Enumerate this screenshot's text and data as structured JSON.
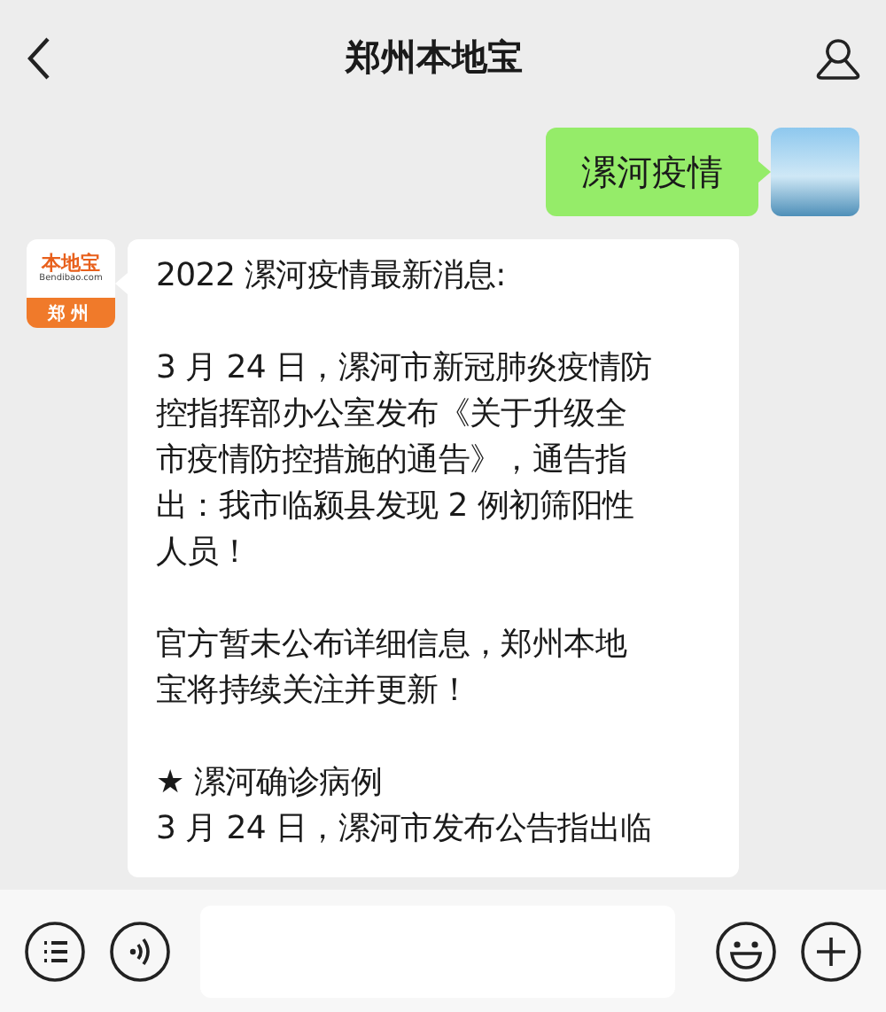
{
  "header": {
    "title": "郑州本地宝"
  },
  "messages": [
    {
      "kind": "outgoing",
      "text": "漯河疫情"
    },
    {
      "kind": "incoming",
      "avatar": {
        "logo": "本地宝",
        "site": "Bendibao.com",
        "city": "郑州"
      },
      "blocks": [
        [
          "2022 漯河疫情最新消息:"
        ],
        [
          "3 月 24 日，漯河市新冠肺炎疫情防控指挥部办公室发布《关于升级全市疫情防控措施的通告》，通告指出：我市临颍县发现 2 例初筛阳性人员！"
        ],
        [
          "官方暂未公布详细信息，郑州本地宝将持续关注并更新！"
        ],
        [
          "★ 漯河确诊病例",
          "3 月 24 日，漯河市发布公告指出临"
        ]
      ]
    }
  ]
}
